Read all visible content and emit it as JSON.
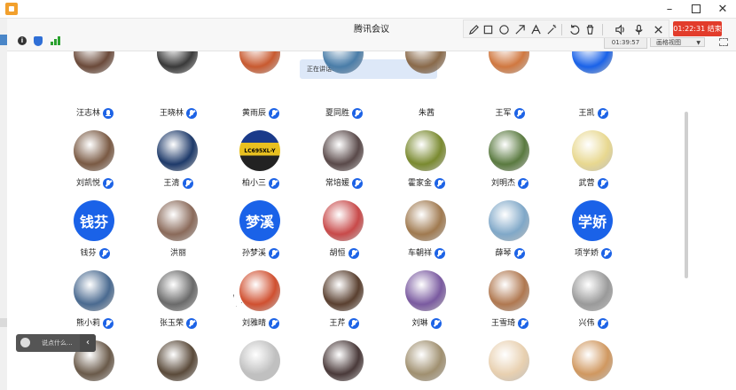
{
  "window": {
    "title": "腾讯会议"
  },
  "header": {
    "meeting_timer": "01:39:57",
    "view_mode": "画格视图",
    "record_time": "01:22:31",
    "record_label": "结束"
  },
  "speaking": {
    "label": "正在讲话:"
  },
  "chat": {
    "placeholder": "说点什么..."
  },
  "colors": {
    "accent": "#1a62e8",
    "record": "#e23c2b"
  },
  "participants": [
    {
      "name": "汪志林",
      "mic": "on",
      "row": 0,
      "col": 0,
      "partial": true,
      "color": "#6b4a3a"
    },
    {
      "name": "王晓林",
      "mic": "off",
      "row": 0,
      "col": 1,
      "partial": true,
      "color": "#3a3a3a"
    },
    {
      "name": "黄雨辰",
      "mic": "off",
      "row": 0,
      "col": 2,
      "partial": true,
      "color": "#c85a30"
    },
    {
      "name": "夏同胜",
      "mic": "off",
      "row": 0,
      "col": 3,
      "partial": true,
      "color": "#4a7da8"
    },
    {
      "name": "朱茜",
      "mic": "none",
      "row": 0,
      "col": 4,
      "partial": true,
      "color": "#8a6a4a"
    },
    {
      "name": "王军",
      "mic": "off",
      "row": 0,
      "col": 5,
      "partial": true,
      "color": "#d07840"
    },
    {
      "name": "王凯",
      "mic": "off",
      "row": 0,
      "col": 6,
      "partial": true,
      "color": "#1a62e8"
    },
    {
      "name": "刘凯悦",
      "mic": "off",
      "row": 1,
      "col": 0,
      "color": "#7a5a44"
    },
    {
      "name": "王清",
      "mic": "off",
      "row": 1,
      "col": 1,
      "color": "#1e3a6a"
    },
    {
      "name": "柏小三",
      "mic": "off",
      "row": 1,
      "col": 2,
      "color": "#e8c020",
      "plate": "LC695XL-Y"
    },
    {
      "name": "常培媛",
      "mic": "off",
      "row": 1,
      "col": 3,
      "color": "#5a4a4a"
    },
    {
      "name": "霍家金",
      "mic": "off",
      "row": 1,
      "col": 4,
      "color": "#7a8a30"
    },
    {
      "name": "刘明杰",
      "mic": "off",
      "row": 1,
      "col": 5,
      "color": "#5a7a40"
    },
    {
      "name": "武营",
      "mic": "off",
      "row": 1,
      "col": 6,
      "color": "#e8d890"
    },
    {
      "name": "钱芬",
      "mic": "off",
      "row": 2,
      "col": 0,
      "text_avatar": "钱芬"
    },
    {
      "name": "洪丽",
      "mic": "none",
      "row": 2,
      "col": 1,
      "color": "#8a6a5a"
    },
    {
      "name": "孙梦溪",
      "mic": "off",
      "row": 2,
      "col": 2,
      "text_avatar": "梦溪"
    },
    {
      "name": "胡恒",
      "mic": "off",
      "row": 2,
      "col": 3,
      "color": "#c84a4a"
    },
    {
      "name": "车朝祥",
      "mic": "off",
      "row": 2,
      "col": 4,
      "color": "#a07a50"
    },
    {
      "name": "薛琴",
      "mic": "off",
      "row": 2,
      "col": 5,
      "color": "#80a8c8"
    },
    {
      "name": "项学娇",
      "mic": "off",
      "row": 2,
      "col": 6,
      "text_avatar": "学娇"
    },
    {
      "name": "熊小莉",
      "mic": "off",
      "row": 3,
      "col": 0,
      "color": "#4a6a90"
    },
    {
      "name": "张玉荣",
      "mic": "off",
      "row": 3,
      "col": 1,
      "color": "#6a6a6a"
    },
    {
      "name": "刘雅晴",
      "mic": "off",
      "row": 3,
      "col": 2,
      "color": "#d05030"
    },
    {
      "name": "王芹",
      "mic": "off",
      "row": 3,
      "col": 3,
      "color": "#5a4030"
    },
    {
      "name": "刘琳",
      "mic": "off",
      "row": 3,
      "col": 4,
      "color": "#7a5aa0"
    },
    {
      "name": "王雪琦",
      "mic": "off",
      "row": 3,
      "col": 5,
      "color": "#b07850"
    },
    {
      "name": "兴伟",
      "mic": "off",
      "row": 3,
      "col": 6,
      "color": "#9a9a9a"
    }
  ],
  "partial_row": [
    {
      "col": 0,
      "color": "#6a5a4a"
    },
    {
      "col": 1,
      "color": "#5a4a3a"
    },
    {
      "col": 2,
      "color": "#c0c0c0"
    },
    {
      "col": 3,
      "color": "#4a3a3a"
    },
    {
      "col": 4,
      "color": "#a09070"
    },
    {
      "col": 5,
      "color": "#e8d0b0"
    },
    {
      "col": 6,
      "color": "#d09860"
    }
  ]
}
